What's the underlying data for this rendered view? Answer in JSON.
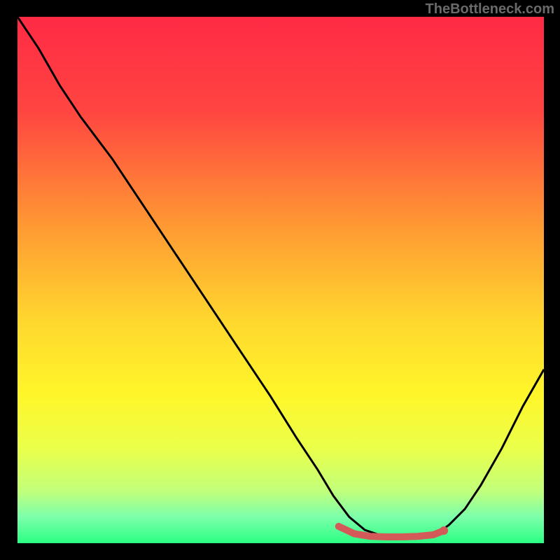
{
  "watermark": "TheBottleneck.com",
  "chart_data": {
    "type": "line",
    "title": "",
    "xlabel": "",
    "ylabel": "",
    "xlim": [
      0,
      100
    ],
    "ylim": [
      0,
      100
    ],
    "gradient_stops": [
      {
        "offset": 0,
        "color": "#ff2a45"
      },
      {
        "offset": 18,
        "color": "#ff4541"
      },
      {
        "offset": 40,
        "color": "#ff9a33"
      },
      {
        "offset": 58,
        "color": "#ffd82e"
      },
      {
        "offset": 72,
        "color": "#fff62a"
      },
      {
        "offset": 82,
        "color": "#eaff4a"
      },
      {
        "offset": 90,
        "color": "#c2ff7a"
      },
      {
        "offset": 95,
        "color": "#7dffab"
      },
      {
        "offset": 100,
        "color": "#2bff83"
      }
    ],
    "series": [
      {
        "name": "bottleneck-curve",
        "type": "line",
        "x": [
          0,
          4,
          8,
          12,
          18,
          24,
          30,
          36,
          42,
          48,
          53,
          57,
          60,
          63,
          66,
          69,
          72,
          76,
          80,
          82,
          85,
          88,
          92,
          96,
          100
        ],
        "y": [
          100,
          94,
          87,
          81,
          73,
          64,
          55,
          46,
          37,
          28,
          20,
          14,
          9,
          5,
          2.5,
          1.5,
          1.2,
          1.2,
          2.0,
          3.5,
          6.5,
          11,
          18,
          26,
          33
        ]
      },
      {
        "name": "trough-highlight",
        "type": "line",
        "stroke": "#d45a5a",
        "stroke_width": 10,
        "x": [
          61,
          64,
          67,
          70,
          73,
          76,
          79,
          81
        ],
        "y": [
          3.2,
          1.8,
          1.3,
          1.2,
          1.2,
          1.3,
          1.6,
          2.4
        ]
      },
      {
        "name": "trough-end-dot",
        "type": "scatter",
        "fill": "#d45a5a",
        "r": 6,
        "x": [
          81
        ],
        "y": [
          2.4
        ]
      }
    ]
  }
}
